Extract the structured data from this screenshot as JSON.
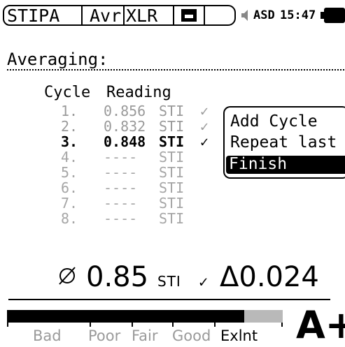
{
  "status_bar": {
    "tabs": [
      "STIPA",
      "Avr",
      "XLR"
    ],
    "asd": "ASD",
    "time": "15:47"
  },
  "title": "Averaging:",
  "table": {
    "headers": [
      "Cycle",
      "Reading"
    ],
    "rows": [
      {
        "num": "1.",
        "value": "0.856",
        "unit": "STI",
        "check": "✓",
        "state": "done"
      },
      {
        "num": "2.",
        "value": "0.832",
        "unit": "STI",
        "check": "✓",
        "state": "done"
      },
      {
        "num": "3.",
        "value": "0.848",
        "unit": "STI",
        "check": "✓",
        "state": "current"
      },
      {
        "num": "4.",
        "value": "----",
        "unit": "STI",
        "check": "",
        "state": "empty"
      },
      {
        "num": "5.",
        "value": "----",
        "unit": "STI",
        "check": "",
        "state": "empty"
      },
      {
        "num": "6.",
        "value": "----",
        "unit": "STI",
        "check": "",
        "state": "empty"
      },
      {
        "num": "7.",
        "value": "----",
        "unit": "STI",
        "check": "",
        "state": "empty"
      },
      {
        "num": "8.",
        "value": "----",
        "unit": "STI",
        "check": "",
        "state": "empty"
      }
    ]
  },
  "menu": {
    "items": [
      "Add Cycle",
      "Repeat last",
      "Finish"
    ],
    "selected": "Finish"
  },
  "average": {
    "value": "0.85",
    "unit": "STI",
    "check": "✓",
    "delta": "Δ0.024"
  },
  "rating": {
    "labels": [
      "Bad",
      "Poor",
      "Fair",
      "Good",
      "Exlnt"
    ],
    "level": 0.86,
    "grade": "A+"
  },
  "colors": {
    "faded_text": "#9a9a9a",
    "bar_fill": "#000000",
    "bar_remainder": "#b9b9b9"
  },
  "icons": [
    "save-icon",
    "speaker-icon",
    "battery-icon",
    "diameter-icon"
  ]
}
